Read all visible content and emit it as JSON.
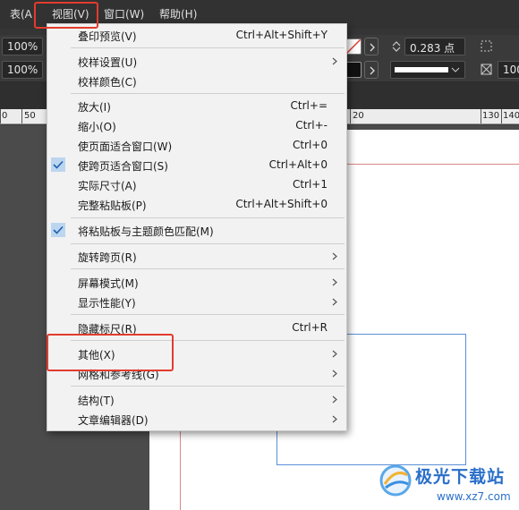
{
  "menubar": {
    "items": [
      "表(A",
      "视图(V)",
      "窗口(W)",
      "帮助(H)"
    ]
  },
  "controls": {
    "row1_field": "100%",
    "row2_field": "100%",
    "stroke_value": "0.283 点",
    "right_field": "100"
  },
  "ruler": {
    "left_ticks": [
      "0",
      "50"
    ],
    "right_ticks": [
      "20",
      "130",
      "140"
    ]
  },
  "view_menu": {
    "items": [
      {
        "label": "叠印预览(V)",
        "shortcut": "Ctrl+Alt+Shift+Y",
        "submenu": false,
        "checked": false
      },
      {
        "label": "校样设置(U)",
        "shortcut": "",
        "submenu": true,
        "checked": false
      },
      {
        "label": "校样颜色(C)",
        "shortcut": "",
        "submenu": false,
        "checked": false
      },
      {
        "label": "放大(I)",
        "shortcut": "Ctrl+=",
        "submenu": false,
        "checked": false
      },
      {
        "label": "缩小(O)",
        "shortcut": "Ctrl+-",
        "submenu": false,
        "checked": false
      },
      {
        "label": "使页面适合窗口(W)",
        "shortcut": "Ctrl+0",
        "submenu": false,
        "checked": false
      },
      {
        "label": "使跨页适合窗口(S)",
        "shortcut": "Ctrl+Alt+0",
        "submenu": false,
        "checked": true
      },
      {
        "label": "实际尺寸(A)",
        "shortcut": "Ctrl+1",
        "submenu": false,
        "checked": false
      },
      {
        "label": "完整粘贴板(P)",
        "shortcut": "Ctrl+Alt+Shift+0",
        "submenu": false,
        "checked": false
      },
      {
        "label": "将粘贴板与主题颜色匹配(M)",
        "shortcut": "",
        "submenu": false,
        "checked": true
      },
      {
        "label": "旋转跨页(R)",
        "shortcut": "",
        "submenu": true,
        "checked": false
      },
      {
        "label": "屏幕模式(M)",
        "shortcut": "",
        "submenu": true,
        "checked": false
      },
      {
        "label": "显示性能(Y)",
        "shortcut": "",
        "submenu": true,
        "checked": false
      },
      {
        "label": "隐藏标尺(R)",
        "shortcut": "Ctrl+R",
        "submenu": false,
        "checked": false
      },
      {
        "label": "其他(X)",
        "shortcut": "",
        "submenu": true,
        "checked": false
      },
      {
        "label": "网格和参考线(G)",
        "shortcut": "",
        "submenu": true,
        "checked": false
      },
      {
        "label": "结构(T)",
        "shortcut": "",
        "submenu": true,
        "checked": false
      },
      {
        "label": "文章编辑器(D)",
        "shortcut": "",
        "submenu": true,
        "checked": false
      }
    ]
  },
  "watermark": {
    "brand": "极光下载站",
    "url": "www.xz7.com"
  },
  "colors": {
    "highlight": "#e33b2e",
    "check_bg": "#bcd6f0",
    "menu_bg": "#f2f2f2"
  }
}
